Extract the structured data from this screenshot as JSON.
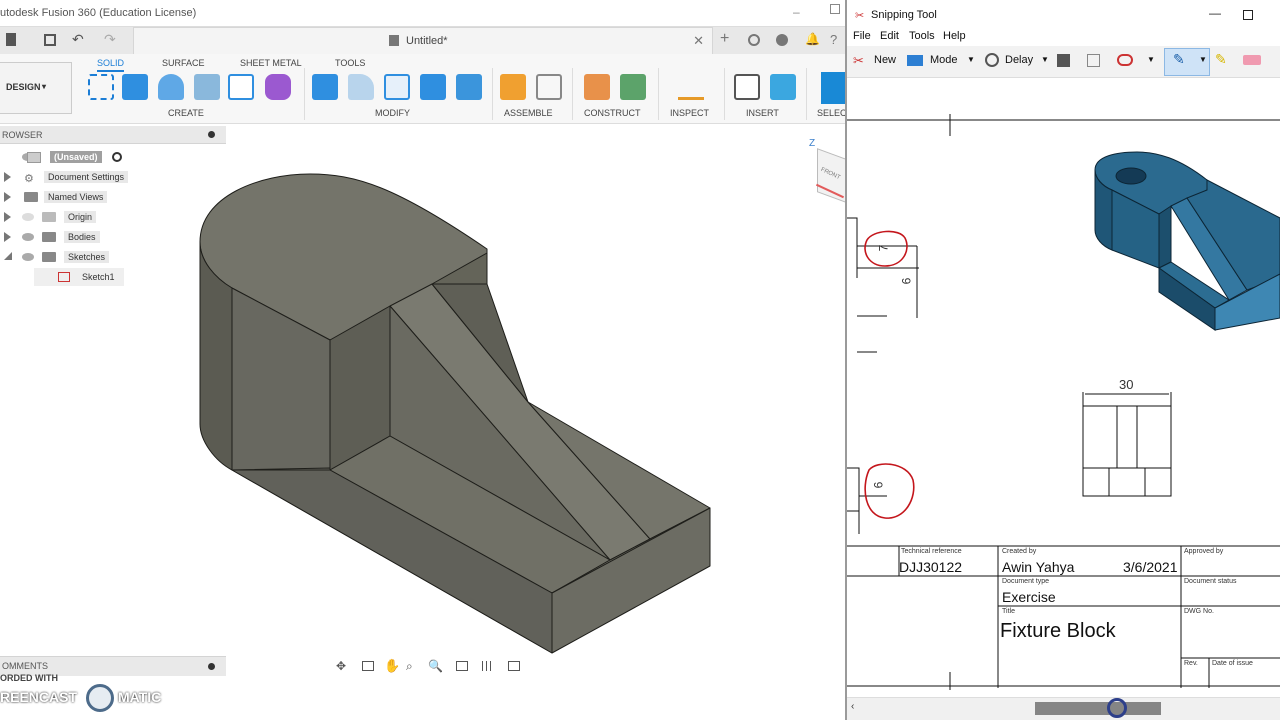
{
  "fusion": {
    "title": "utodesk Fusion 360 (Education License)",
    "doc_tab": "Untitled*",
    "workspace": "DESIGN",
    "ribbon_tabs": [
      "SOLID",
      "SURFACE",
      "SHEET METAL",
      "TOOLS"
    ],
    "groups": [
      "CREATE",
      "MODIFY",
      "ASSEMBLE",
      "CONSTRUCT",
      "INSPECT",
      "INSERT",
      "SELEC"
    ],
    "browser": {
      "header": "ROWSER",
      "items": [
        "(Unsaved)",
        "Document Settings",
        "Named Views",
        "Origin",
        "Bodies",
        "Sketches",
        "Sketch1"
      ]
    },
    "comments": "OMMENTS",
    "viewcube": {
      "axis": "Z",
      "face": "FRONT"
    },
    "watermark": {
      "line1": "ORDED WITH",
      "line2": "REENCAST",
      "line3": "MATIC"
    }
  },
  "snip": {
    "title": "Snipping Tool",
    "menu": [
      "File",
      "Edit",
      "Tools",
      "Help"
    ],
    "toolbar": {
      "new": "New",
      "mode": "Mode",
      "delay": "Delay"
    },
    "drawing": {
      "dims": {
        "d1": "7",
        "d2": "6",
        "d3": "30",
        "d4": "6"
      },
      "title_block": {
        "tech_ref_label": "Technical reference",
        "tech_ref": "DJJ30122",
        "created_by_label": "Created by",
        "created_by": "Awin Yahya",
        "date": "3/6/2021",
        "approved_by_label": "Approved by",
        "doc_type_label": "Document type",
        "doc_type": "Exercise",
        "doc_status_label": "Document status",
        "title_label": "Title",
        "title": "Fixture Block",
        "dwg_label": "DWG No.",
        "rev_label": "Rev.",
        "date_issue_label": "Date of issue"
      }
    }
  },
  "colors": {
    "model": "#6b6b5f",
    "accent": "#1c7ed6",
    "iso_blue": "#2f6d93",
    "markup": "#c4161c"
  }
}
